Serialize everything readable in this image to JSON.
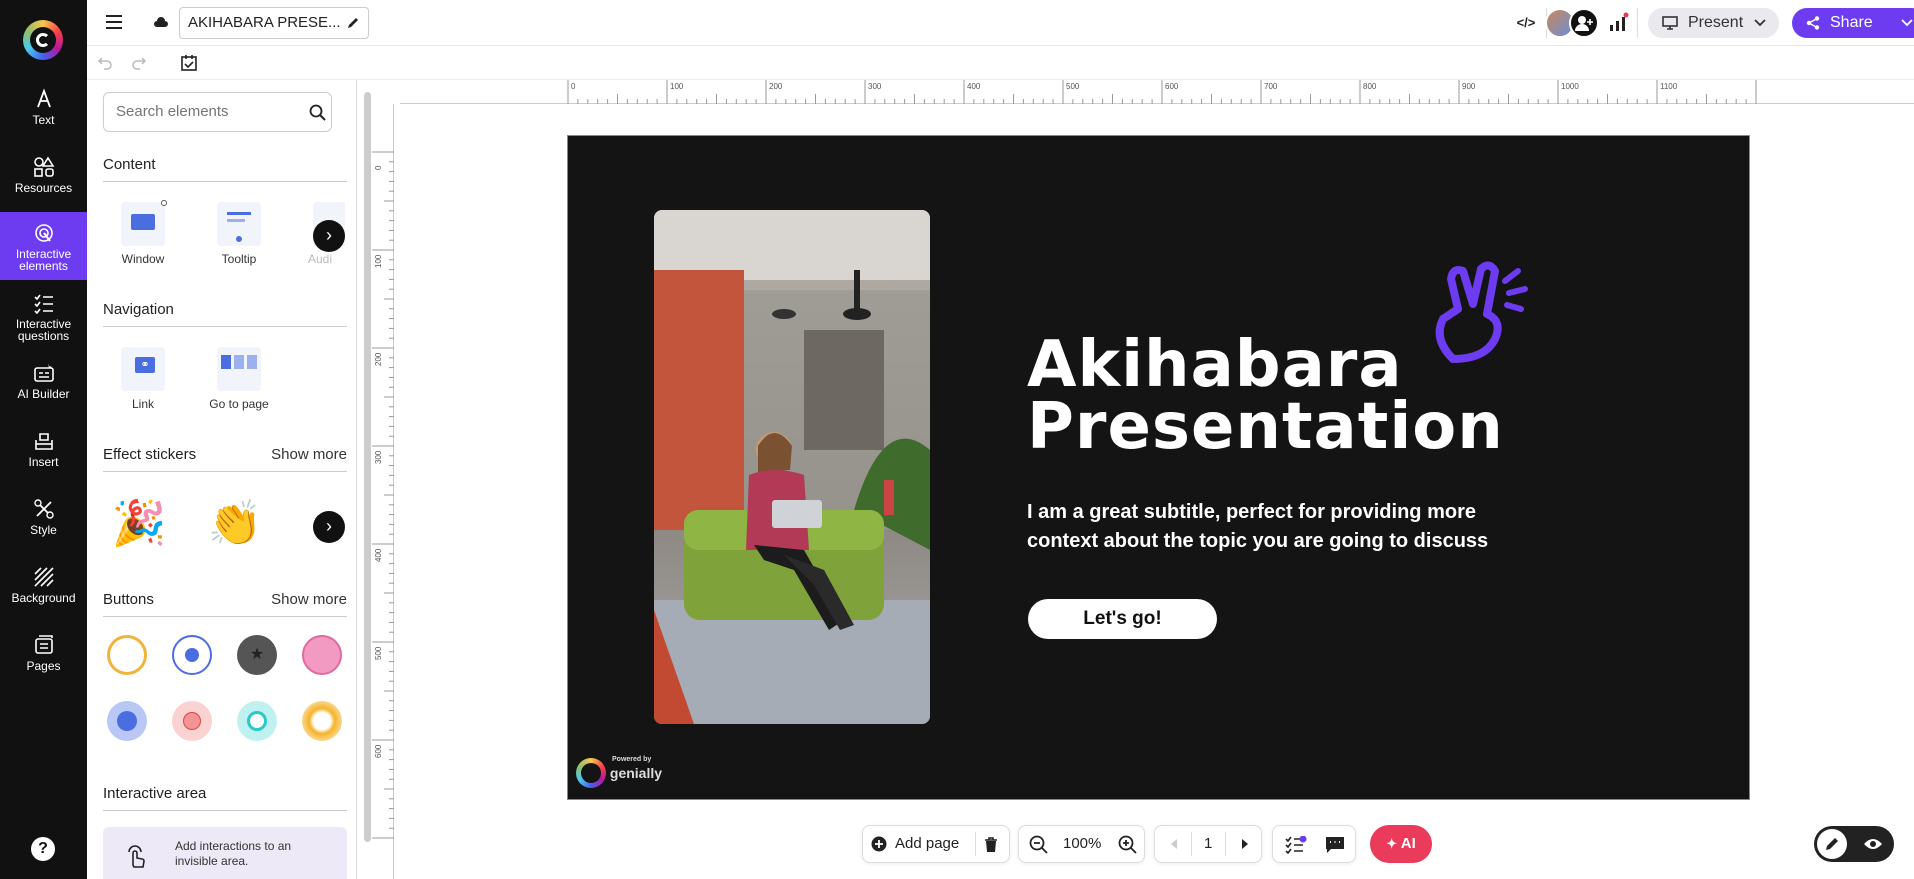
{
  "topbar": {
    "title": "AKIHABARA PRESE...",
    "present_label": "Present",
    "share_label": "Share",
    "embed_icon": "code-icon"
  },
  "rail": {
    "items": [
      {
        "label": "Text",
        "icon": "text-icon"
      },
      {
        "label": "Resources",
        "icon": "shapes-icon"
      },
      {
        "label": "Interactive elements",
        "icon": "interactive-icon"
      },
      {
        "label": "Interactive questions",
        "icon": "questions-icon"
      },
      {
        "label": "AI Builder",
        "icon": "ai-builder-icon"
      },
      {
        "label": "Insert",
        "icon": "insert-icon"
      },
      {
        "label": "Style",
        "icon": "style-icon"
      },
      {
        "label": "Background",
        "icon": "background-icon"
      },
      {
        "label": "Pages",
        "icon": "pages-icon"
      }
    ],
    "help": "?"
  },
  "panel": {
    "search_placeholder": "Search elements",
    "content": {
      "title": "Content",
      "tiles": [
        "Window",
        "Tooltip",
        "Audi"
      ]
    },
    "navigation": {
      "title": "Navigation",
      "tiles": [
        "Link",
        "Go to page"
      ]
    },
    "stickers": {
      "title": "Effect stickers",
      "more": "Show more"
    },
    "buttons": {
      "title": "Buttons",
      "more": "Show more"
    },
    "area": {
      "title": "Interactive area",
      "desc": "Add interactions to an invisible area."
    }
  },
  "ruler": {
    "h": [
      "0",
      "100",
      "200",
      "300",
      "400",
      "500",
      "600",
      "700",
      "800",
      "900",
      "1000",
      "1100"
    ],
    "v": [
      "0",
      "100",
      "200",
      "300",
      "400",
      "500",
      "600"
    ]
  },
  "slide": {
    "title_line1": "Akihabara",
    "title_line2": "Presentation",
    "subtitle": "I am a great subtitle, perfect for providing more context about the topic you are going to discuss",
    "button": "Let's go!",
    "powered": "genially",
    "powered_small": "Powered by"
  },
  "bottombar": {
    "add_page": "Add page",
    "zoom": "100%",
    "page": "1",
    "ai": "AI"
  }
}
